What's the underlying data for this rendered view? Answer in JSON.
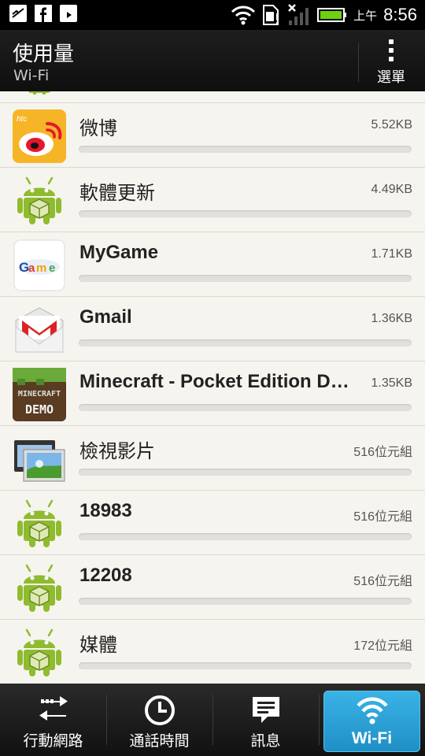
{
  "status_bar": {
    "ampm": "上午",
    "time": "8:56",
    "icons": [
      "gallery-icon",
      "facebook-icon",
      "play-store-icon",
      "wifi-icon",
      "sim-icon",
      "signal-icon",
      "battery-icon"
    ]
  },
  "action_bar": {
    "title": "使用量",
    "subtitle": "Wi-Fi",
    "menu_label": "選單"
  },
  "apps": [
    {
      "name": "微博",
      "size": "5.52KB",
      "icon": "weibo-icon",
      "bold": false
    },
    {
      "name": "軟體更新",
      "size": "4.49KB",
      "icon": "android-icon",
      "bold": false
    },
    {
      "name": "MyGame",
      "size": "1.71KB",
      "icon": "mygame-icon",
      "bold": true
    },
    {
      "name": "Gmail",
      "size": "1.36KB",
      "icon": "gmail-icon",
      "bold": true
    },
    {
      "name": "Minecraft - Pocket Edition Demo",
      "size": "1.35KB",
      "icon": "minecraft-icon",
      "bold": true
    },
    {
      "name": "檢視影片",
      "size": "516位元組",
      "icon": "video-viewer-icon",
      "bold": false
    },
    {
      "name": "18983",
      "size": "516位元組",
      "icon": "android-icon",
      "bold": true
    },
    {
      "name": "12208",
      "size": "516位元組",
      "icon": "android-icon",
      "bold": true
    },
    {
      "name": "媒體",
      "size": "172位元組",
      "icon": "android-icon",
      "bold": false
    }
  ],
  "bottom_tabs": [
    {
      "label": "行動網路",
      "icon": "mobile-network-icon",
      "active": false
    },
    {
      "label": "通話時間",
      "icon": "clock-icon",
      "active": false
    },
    {
      "label": "訊息",
      "icon": "message-icon",
      "active": false
    },
    {
      "label": "Wi-Fi",
      "icon": "wifi-icon",
      "active": true
    }
  ],
  "colors": {
    "accent": "#2aa3d8",
    "list_background": "#f6f4ef",
    "android_green": "#8fbb2f"
  }
}
